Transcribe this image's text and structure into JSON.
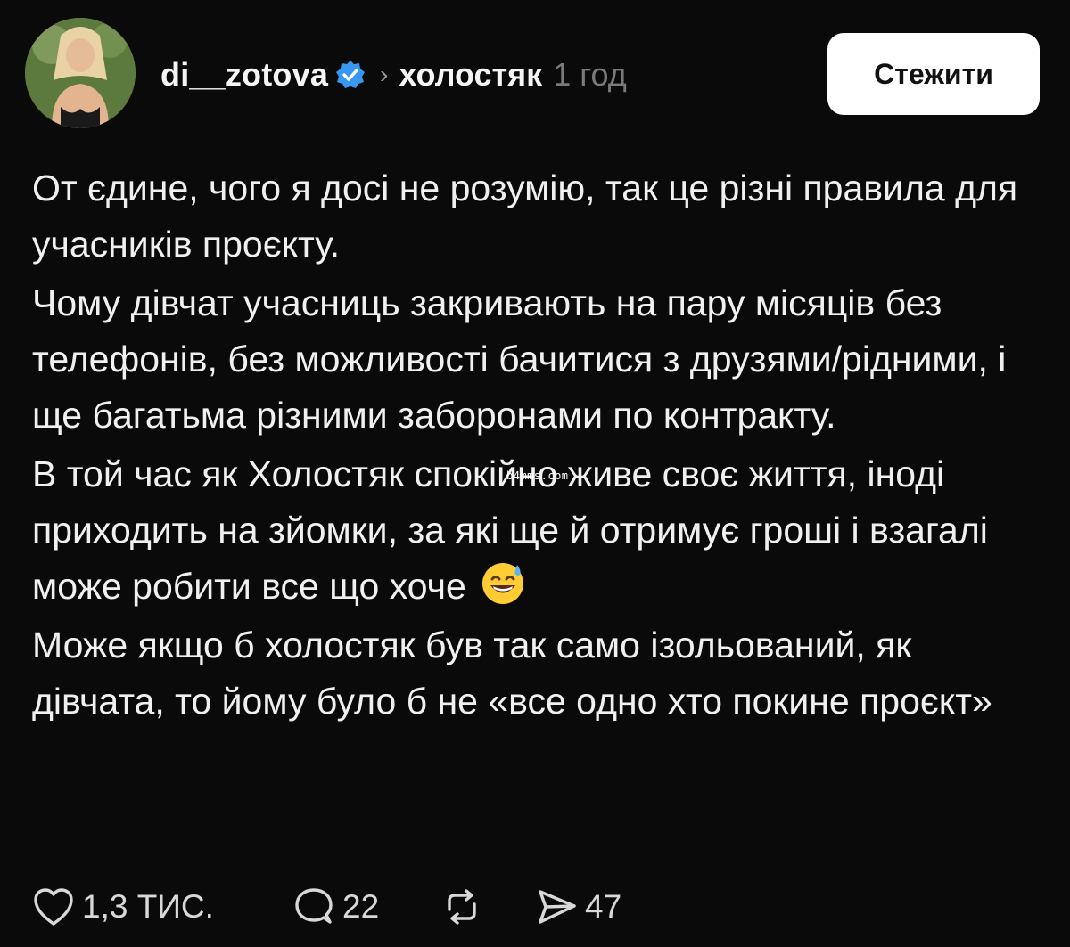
{
  "post": {
    "author": {
      "username": "di__zotova",
      "verified": true,
      "avatar_icon": "avatar-photo"
    },
    "chevron_icon": "chevron-right-icon",
    "topic": "холостяк",
    "time_ago": "1 год",
    "follow_label": "Стежити",
    "paragraphs": [
      "От єдине, чого я досі не розумію, так це різні правила для учасників проєкту.",
      "Чому дівчат учасниць закривають на пару місяців без телефонів, без можливості бачитися з друзями/рідними, і ще багатьма різними заборонами по контракту.",
      "В той час як Холостяк спокійно живе своє життя, іноді приходить на зйомки, за які ще й отримує гроші і взагалі може робити все що хоче",
      "Може якщо б холостяк був так само ізольований, як дівчата, то йому було б не «все одно хто покине проєкт»"
    ],
    "emoji": "grinning-face-with-sweat-emoji",
    "watermark": "b4mms.com",
    "actions": {
      "likes": "1,3 ТИС.",
      "comments": "22",
      "shares": "47"
    }
  },
  "colors": {
    "background": "#0a0a0a",
    "text": "#f0f0f0",
    "muted": "#7a7a7a",
    "verified_blue": "#3897f0",
    "button_bg": "#ffffff"
  }
}
